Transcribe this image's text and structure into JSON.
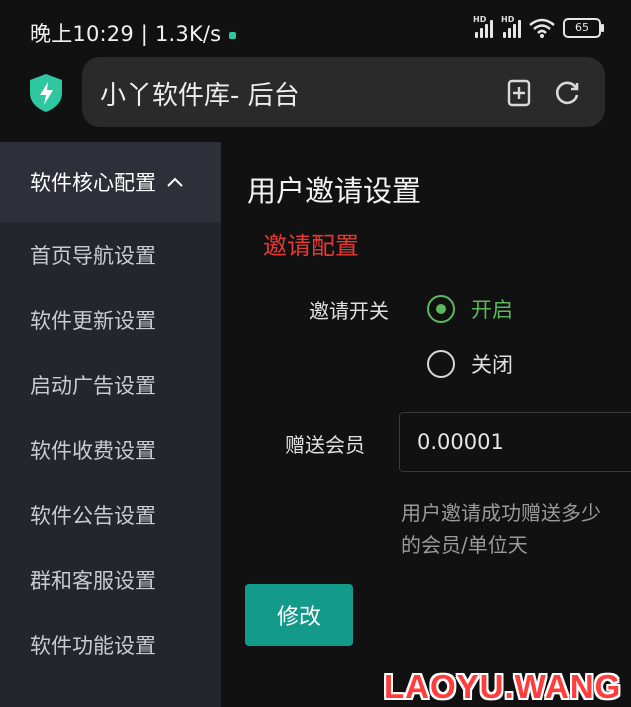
{
  "status_bar": {
    "time_speed": "晚上10:29 | 1.3K/s",
    "battery": "65",
    "signal_tag": "HD"
  },
  "browser": {
    "url_title": "小丫软件库- 后台",
    "accent_color": "#2fc7a0"
  },
  "sidebar": {
    "header": "软件核心配置",
    "items": [
      {
        "label": "首页导航设置"
      },
      {
        "label": "软件更新设置"
      },
      {
        "label": "启动广告设置"
      },
      {
        "label": "软件收费设置"
      },
      {
        "label": "软件公告设置"
      },
      {
        "label": "群和客服设置"
      },
      {
        "label": "软件功能设置"
      }
    ]
  },
  "main": {
    "page_title": "用户邀请设置",
    "section_title": "邀请配置",
    "invite_switch_label": "邀请开关",
    "options": [
      {
        "label": "开启",
        "selected": true
      },
      {
        "label": "关闭",
        "selected": false
      }
    ],
    "member_label": "赠送会员",
    "member_value": "0.00001",
    "help_line1": "用户邀请成功赠送多少",
    "help_line2": "的会员/单位天",
    "submit_label": "修改"
  },
  "watermark": "LAOYU.WANG"
}
